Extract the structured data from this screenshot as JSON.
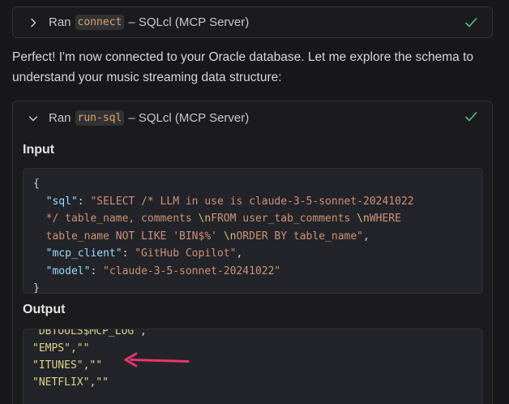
{
  "tool_calls": [
    {
      "prefix": "Ran",
      "tool": "connect",
      "source": "– SQLcl (MCP Server)",
      "expanded": false,
      "status_icon": "check-icon"
    },
    {
      "prefix": "Ran",
      "tool": "run-sql",
      "source": "– SQLcl (MCP Server)",
      "expanded": true,
      "status_icon": "check-icon",
      "input_label": "Input",
      "output_label": "Output",
      "input": {
        "open": "{",
        "close": "}",
        "sql_key": "\"sql\"",
        "sql_line1": "\"SELECT /* LLM in use is claude-3-5-sonnet-20241022",
        "sql_line2a": "*/ table_name, comments ",
        "sql_esc1": "\\n",
        "sql_line2b": "FROM user_tab_comments ",
        "sql_esc2": "\\n",
        "sql_line2c": "WHERE",
        "sql_line3a": "table_name NOT LIKE 'BIN$%' ",
        "sql_esc3": "\\n",
        "sql_line3b": "ORDER BY table_name\"",
        "mcp_client_key": "\"mcp_client\"",
        "mcp_client_value": "\"GitHub Copilot\"",
        "model_key": "\"model\"",
        "model_value": "\"claude-3-5-sonnet-20241022\""
      },
      "output_lines": [
        "\"DBTOOLS$MCP_LOG\",\"\"",
        "\"EMPS\",\"\"",
        "\"ITUNES\",\"\"",
        "\"NETFLIX\",\"\""
      ]
    }
  ],
  "message": "Perfect! I'm now connected to your Oracle database. Let me explore the schema to understand your music streaming data structure:",
  "annotation": {
    "arrow_color": "#e8356b",
    "points_to": "\"ITUNES\",\"\""
  },
  "colors": {
    "background": "#18181a",
    "check": "#4ec08a",
    "chip_text": "#d6a56f"
  }
}
